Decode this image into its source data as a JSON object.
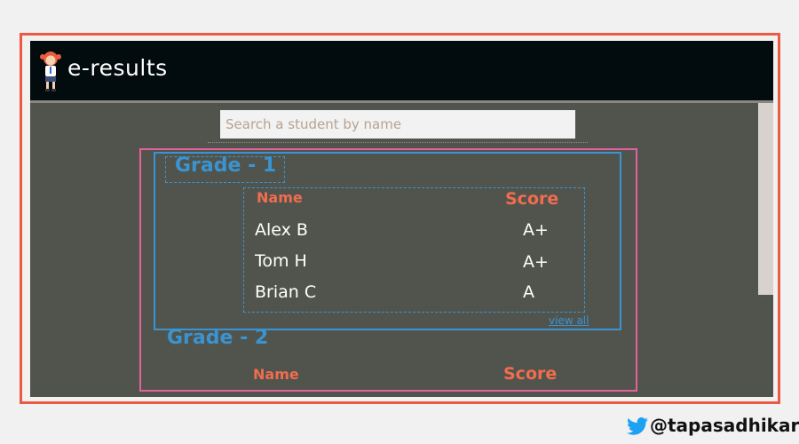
{
  "header": {
    "title": "e-results"
  },
  "search": {
    "placeholder": "Search a student by name",
    "value": ""
  },
  "grades": [
    {
      "title": "Grade - 1",
      "columns": {
        "name": "Name",
        "score": "Score"
      },
      "rows": [
        {
          "name": "Alex B",
          "score": "A+"
        },
        {
          "name": "Tom H",
          "score": "A+"
        },
        {
          "name": "Brian C",
          "score": "A"
        }
      ],
      "view_all": "view all"
    },
    {
      "title": "Grade - 2",
      "columns": {
        "name": "Name",
        "score": "Score"
      }
    }
  ],
  "footer": {
    "handle": "@tapasadhikary",
    "icon": "twitter-bird-icon"
  },
  "colors": {
    "header_bg": "#020b0d",
    "app_bg": "#51544c",
    "accent_blue": "#3a93d2",
    "accent_pink": "#e5609e",
    "frame_red": "#ec5a45",
    "column_header": "#f26c4f",
    "twitter_blue": "#1da1f2"
  }
}
